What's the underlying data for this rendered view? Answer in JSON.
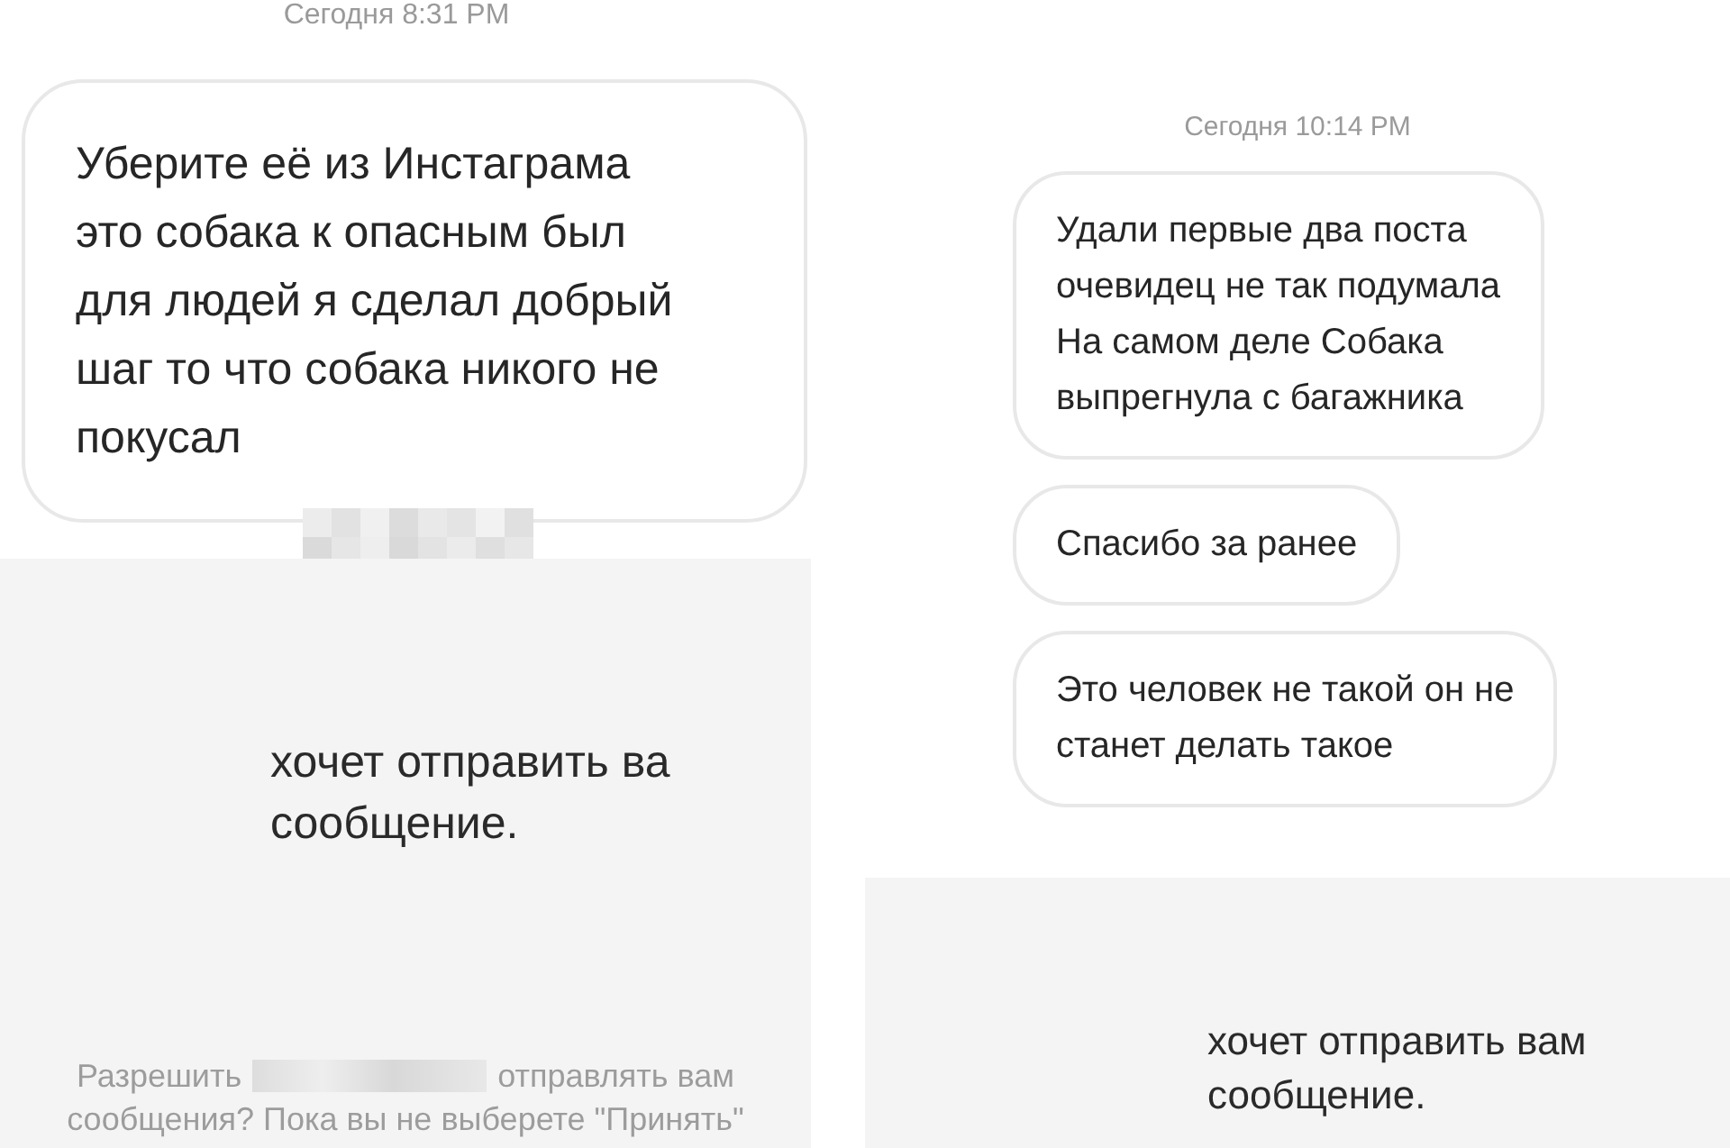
{
  "panels": [
    {
      "timestamp": "Сегодня 8:31 PM",
      "messages": [
        {
          "text": "Уберите её из Инстаграма\nэто собака к опасным был\nдля людей я сделал добрый\nшаг то что собака никого не\nпокусал"
        }
      ],
      "request": {
        "text": "хочет отправить ва\nсообщение.",
        "notice": [
          "Разрешить",
          "отправлять вам",
          "сообщения? Пока вы не выберете \"Принять\""
        ]
      }
    },
    {
      "timestamp": "Сегодня 10:14 PM",
      "messages": [
        {
          "text": "Удали первые два поста\nочевидец не так подумала\nНа самом деле Собака\nвыпрегнула с багажника"
        },
        {
          "text": "Спасибо за ранее"
        },
        {
          "text": "Это человек не такой  он не\nстанет делать такое"
        }
      ],
      "request": {
        "text": "хочет отправить вам\nсообщение."
      }
    }
  ]
}
